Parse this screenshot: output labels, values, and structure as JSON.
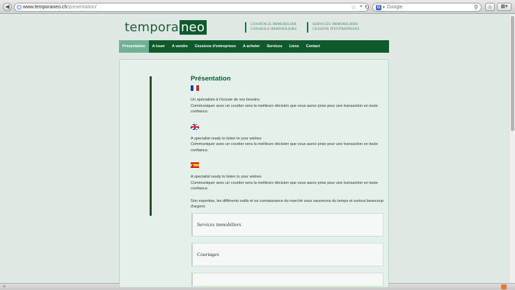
{
  "browser": {
    "url_host": "www.temporaneo.ch",
    "url_path": "/presentation/",
    "search_placeholder": "Google",
    "search_engine_letter": "G"
  },
  "logo": {
    "part1": "tempora",
    "part2": "neo"
  },
  "taglines": [
    {
      "line1": "COURTAGE IMMOBILIER",
      "line2": "CONSEILS IMMOBILIERS"
    },
    {
      "line1": "SERVICES IMMOBILIERS",
      "line2": "CESSION D'ENTREPRISES"
    }
  ],
  "nav": [
    {
      "label": "Présentation",
      "active": true
    },
    {
      "label": "A louer"
    },
    {
      "label": "A vendre"
    },
    {
      "label": "Cessions d'entreprises"
    },
    {
      "label": "A acheter"
    },
    {
      "label": "Services"
    },
    {
      "label": "Liens"
    },
    {
      "label": "Contact"
    }
  ],
  "content": {
    "title": "Présentation",
    "fr": {
      "line1": "Un spécialiste à l'écoute de vos besoins",
      "line2": "Communiquer avec un courtier sera la meilleure décision que vous aurez prise pour une transaction en toute confiance."
    },
    "en": {
      "line1": "A specialist ready to listen to your wishes",
      "line2": "Communiquer avec un courtier sera la meilleure décision que vous aurez prise pour une transaction en toute confiance."
    },
    "es": {
      "line1": "A specialist ready to listen to your wishes",
      "line2": "Communiquer avec un courtier sera la meilleure décision que vous aurez prise pour une transaction en toute confiance."
    },
    "closing": "Son expertise, les différents outils et sa connaissance du marché vous sauverons du temps et surtout beaucoup d'argent."
  },
  "cards": [
    {
      "title": "Services immobiliers"
    },
    {
      "title": "Courtages"
    }
  ],
  "icons": {
    "back": "back-arrow-icon",
    "reload": "reload-icon",
    "bookmark": "star-icon",
    "search": "magnifier-icon",
    "home": "home-icon"
  },
  "colors": {
    "brand_green": "#0f5a2d",
    "active_nav": "#6fb195",
    "page_bg": "#dfe9e4"
  }
}
